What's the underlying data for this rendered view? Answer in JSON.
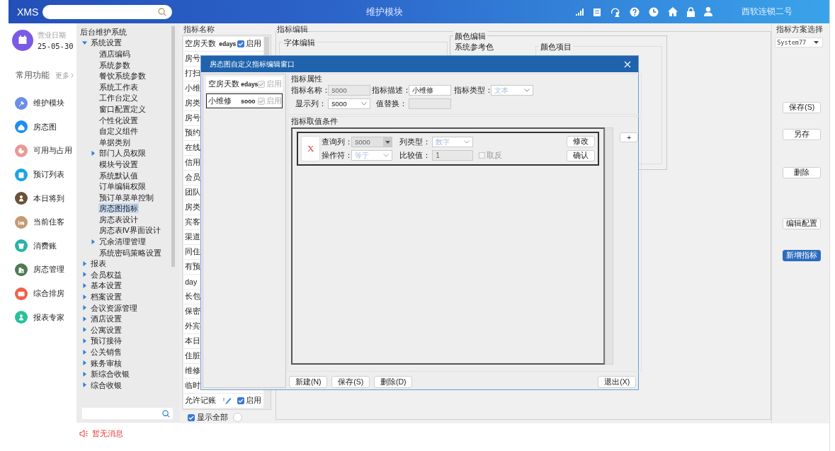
{
  "top_bar": {
    "logo": "XMS",
    "title": "维护模块",
    "user": "西软连锁二号"
  },
  "sidebar": {
    "date_label": "营业日期",
    "date": "25-05-30",
    "section": "常用功能",
    "more": "更多",
    "items": [
      {
        "label": "维护模块",
        "color": "#6b8fe6"
      },
      {
        "label": "房态图",
        "color": "#1e8ff0"
      },
      {
        "label": "可用与占用",
        "color": "#e99a93"
      },
      {
        "label": "预订列表",
        "color": "#1ca3e8"
      },
      {
        "label": "本日将到",
        "color": "#6b5236"
      },
      {
        "label": "当前住客",
        "color": "#c39c76"
      },
      {
        "label": "消费账",
        "color": "#2ab3a8"
      },
      {
        "label": "房态管理",
        "color": "#4f7a52"
      },
      {
        "label": "综合排房",
        "color": "#f0604a"
      },
      {
        "label": "报表专家",
        "color": "#26c29a"
      }
    ]
  },
  "tree": {
    "root": "后台维护系统",
    "items": [
      {
        "label": "系统设置",
        "kind": "folder",
        "expanded": true,
        "selected": false,
        "children": [
          {
            "label": "酒店编码",
            "kind": "leaf",
            "selected": false
          },
          {
            "label": "系统参数",
            "kind": "leaf",
            "selected": false
          },
          {
            "label": "餐饮系统参数",
            "kind": "leaf",
            "selected": false
          },
          {
            "label": "系统工作表",
            "kind": "leaf",
            "selected": false
          },
          {
            "label": "工作台定义",
            "kind": "leaf",
            "selected": false
          },
          {
            "label": "窗口配置定义",
            "kind": "leaf",
            "selected": false
          },
          {
            "label": "个性化设置",
            "kind": "leaf",
            "selected": false
          },
          {
            "label": "自定义组件",
            "kind": "leaf",
            "selected": false
          },
          {
            "label": "单据类别",
            "kind": "leaf",
            "selected": false
          },
          {
            "label": "部门人员权限",
            "kind": "folder",
            "expanded": false,
            "selected": false
          },
          {
            "label": "模块号设置",
            "kind": "leaf",
            "selected": false
          },
          {
            "label": "系统默认值",
            "kind": "leaf",
            "selected": false
          },
          {
            "label": "订单编辑权限",
            "kind": "leaf",
            "selected": false
          },
          {
            "label": "预订单菜单控制",
            "kind": "leaf",
            "selected": false
          },
          {
            "label": "房态图指标",
            "kind": "leaf",
            "selected": true
          },
          {
            "label": "房态表设计",
            "kind": "leaf",
            "selected": false
          },
          {
            "label": "房态表Ⅳ界面设计",
            "kind": "leaf",
            "selected": false
          },
          {
            "label": "冗余清理管理",
            "kind": "folder",
            "expanded": false,
            "selected": false
          },
          {
            "label": "系统密码策略设置",
            "kind": "leaf",
            "selected": false
          }
        ]
      },
      {
        "label": "报表",
        "kind": "folder",
        "expanded": false,
        "selected": false
      },
      {
        "label": "会员权益",
        "kind": "folder",
        "expanded": false,
        "selected": false
      },
      {
        "label": "基本设置",
        "kind": "folder",
        "expanded": false,
        "selected": false
      },
      {
        "label": "档案设置",
        "kind": "folder",
        "expanded": false,
        "selected": false
      },
      {
        "label": "会议资源管理",
        "kind": "folder",
        "expanded": false,
        "selected": false
      },
      {
        "label": "酒店设置",
        "kind": "folder",
        "expanded": false,
        "selected": false
      },
      {
        "label": "公寓设置",
        "kind": "folder",
        "expanded": false,
        "selected": false
      },
      {
        "label": "预订接待",
        "kind": "folder",
        "expanded": false,
        "selected": false
      },
      {
        "label": "公关销售",
        "kind": "folder",
        "expanded": false,
        "selected": false
      },
      {
        "label": "账务审核",
        "kind": "folder",
        "expanded": false,
        "selected": false
      },
      {
        "label": "新综合收银",
        "kind": "folder",
        "expanded": false,
        "selected": false
      },
      {
        "label": "综合收银",
        "kind": "folder",
        "expanded": false,
        "selected": false
      }
    ]
  },
  "message": "暂无消息",
  "indicator_list": {
    "title": "指标名称",
    "rows": [
      {
        "kind": "full",
        "label": "空房天数",
        "code": "edays",
        "enabled": true,
        "enabled_label": "启用"
      },
      {
        "kind": "cut",
        "label": "房号"
      },
      {
        "kind": "cut",
        "label": "打扫"
      },
      {
        "kind": "cut",
        "label": "小维"
      },
      {
        "kind": "cut",
        "label": "房类"
      },
      {
        "kind": "cut",
        "label": "房号"
      },
      {
        "kind": "cut",
        "label": "预约"
      },
      {
        "kind": "cut",
        "label": "在线"
      },
      {
        "kind": "cut",
        "label": "信用"
      },
      {
        "kind": "cut",
        "label": "会员"
      },
      {
        "kind": "cut",
        "label": "团队"
      },
      {
        "kind": "cut",
        "label": "房类"
      },
      {
        "kind": "cut",
        "label": "宾客"
      },
      {
        "kind": "cut",
        "label": "渠道"
      },
      {
        "kind": "cut",
        "label": "同住"
      },
      {
        "kind": "cut",
        "label": "有预"
      },
      {
        "kind": "cut",
        "label": "day"
      },
      {
        "kind": "cut",
        "label": "长包"
      },
      {
        "kind": "cut",
        "label": "保密"
      },
      {
        "kind": "cut",
        "label": "外宾"
      },
      {
        "kind": "cut",
        "label": "本日"
      },
      {
        "kind": "cut",
        "label": "住脏"
      },
      {
        "kind": "cut",
        "label": "维修"
      },
      {
        "kind": "cut",
        "label": "临时"
      },
      {
        "kind": "icon",
        "label": "允许记账",
        "enabled": true,
        "enabled_label": "启用"
      }
    ],
    "show_all": {
      "label": "显示全部",
      "checked": true
    },
    "option": {
      "selected": false
    }
  },
  "editor": {
    "title": "指标编辑",
    "font_group": "字体编辑",
    "color_group": "颜色编辑",
    "reference_color": "系统参考色",
    "color_items": "颜色项目"
  },
  "scheme": {
    "title": "指标方案选择",
    "value": "System77",
    "buttons": [
      {
        "label": "保存(S)",
        "kind": "plain"
      },
      {
        "label": "另存",
        "kind": "plain"
      },
      {
        "label": "删除",
        "kind": "plain"
      },
      {
        "label": "编辑配置",
        "kind": "plain"
      },
      {
        "label": "新增指标",
        "kind": "primary"
      }
    ]
  },
  "dialog": {
    "title": "房态图自定义指标编辑窗口",
    "items": [
      {
        "label": "空房天数",
        "code": "edays",
        "enabled": true,
        "disabled": true,
        "enabled_label": "启用",
        "selected": false
      },
      {
        "label": "小维修",
        "code": "sooo",
        "enabled": true,
        "disabled": true,
        "enabled_label": "启用",
        "selected": true
      }
    ],
    "attributes": {
      "title": "指标属性",
      "fields": [
        {
          "label": "指标名称：",
          "value": "sooo",
          "kind": "text",
          "disabled": true
        },
        {
          "label": "指标描述：",
          "value": "小维修",
          "kind": "text",
          "disabled": false
        },
        {
          "label": "指标类型：",
          "value": "文本",
          "kind": "select",
          "disabled": true
        },
        {
          "label": "显示列：",
          "value": "sooo",
          "kind": "select",
          "disabled": false
        },
        {
          "label": "值替换：",
          "kind": "text",
          "disabled": true
        }
      ]
    },
    "conditions": {
      "title": "指标取值条件",
      "add": "+",
      "items": [
        {
          "remove": "X",
          "fields": [
            {
              "label": "查询列：",
              "value": "sooo",
              "kind": "combo",
              "disabled": true
            },
            {
              "label": "列类型：",
              "value": "数字",
              "kind": "select",
              "disabled": true
            },
            {
              "label": "操作符：",
              "value": "等于",
              "kind": "select",
              "disabled": true
            },
            {
              "label": "比较值：",
              "value": "1",
              "kind": "text",
              "disabled": true
            }
          ],
          "invert": {
            "label": "取反",
            "checked": false
          },
          "edit": "修改",
          "confirm": "确认"
        }
      ]
    },
    "buttons": [
      {
        "label": "新建(N)"
      },
      {
        "label": "保存(S)"
      },
      {
        "label": "删除(D)"
      },
      {
        "label": "退出(X)"
      }
    ]
  }
}
